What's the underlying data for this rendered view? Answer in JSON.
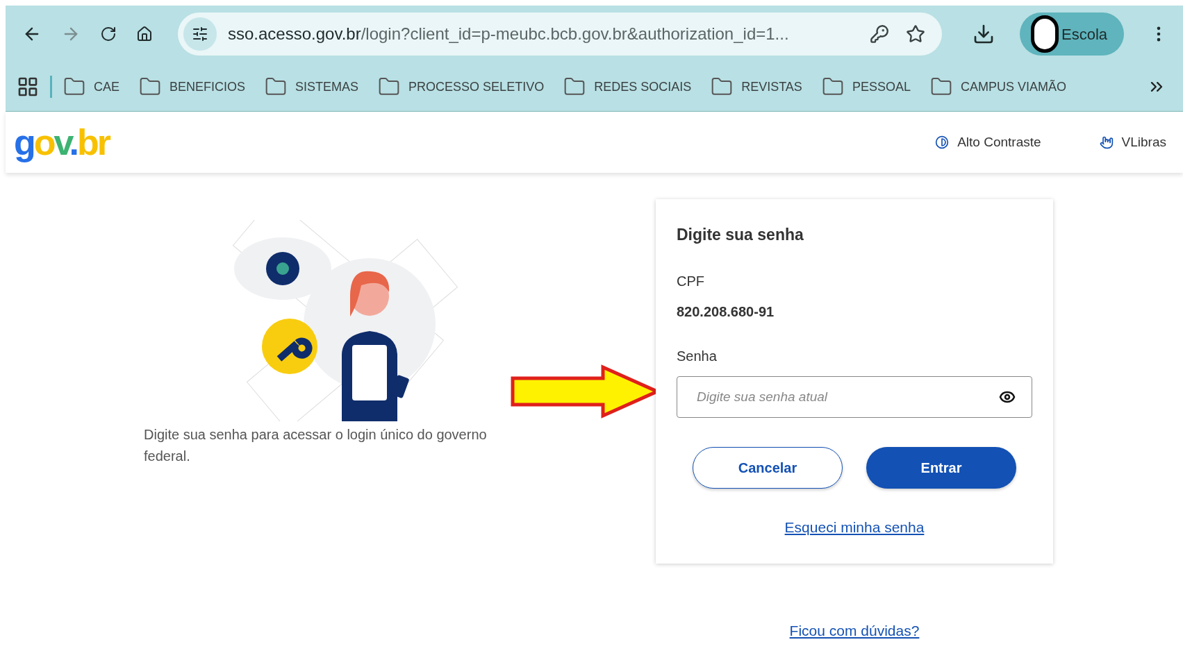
{
  "browser": {
    "url": {
      "domain": "sso.acesso.gov.br",
      "path": "/login?client_id=p-meubc.bcb.gov.br&authorization_id=1..."
    },
    "profile": "Escola",
    "bookmarks": [
      {
        "label": "CAE"
      },
      {
        "label": "BENEFICIOS"
      },
      {
        "label": "SISTEMAS"
      },
      {
        "label": "PROCESSO SELETIVO"
      },
      {
        "label": "REDES SOCIAIS"
      },
      {
        "label": "REVISTAS"
      },
      {
        "label": "PESSOAL"
      },
      {
        "label": "CAMPUS VIAMÃO"
      }
    ]
  },
  "header": {
    "logo": {
      "g": "g",
      "o": "o",
      "v": "v",
      ".": ".",
      "br": "br"
    },
    "actions": [
      {
        "kind": "contrast",
        "label": "Alto Contraste"
      },
      {
        "kind": "libras",
        "label": "VLibras"
      }
    ]
  },
  "intro": {
    "text": "Digite sua senha para acessar o login único do governo federal."
  },
  "form": {
    "title": "Digite sua senha",
    "cpf_label": "CPF",
    "cpf_value": "820.208.680-91",
    "password_label": "Senha",
    "password": {
      "placeholder": "Digite sua senha atual"
    },
    "buttons": [
      {
        "kind": "secondary",
        "label": "Cancelar"
      },
      {
        "kind": "primary",
        "label": "Entrar"
      }
    ],
    "forgot_link": "Esqueci minha senha"
  },
  "help_link": "Ficou com dúvidas?"
}
